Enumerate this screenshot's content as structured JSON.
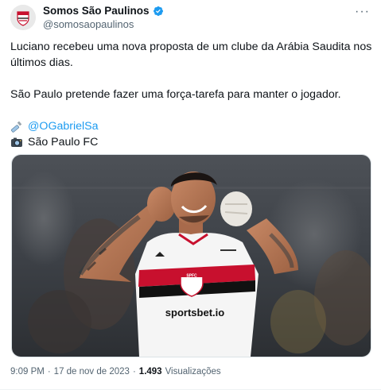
{
  "account": {
    "name": "Somos São Paulinos",
    "handle": "@somosaopaulinos",
    "badge": "verified-icon",
    "accent": "#1d9bf0"
  },
  "menu": {
    "more_label": "···"
  },
  "tweet": {
    "line1": "Luciano recebeu uma nova proposta de um clube da Arábia Saudita nos últimos dias.",
    "line2": "São Paulo pretende fazer uma força-tarefa para manter o jogador.",
    "credit_writer": "@OGabrielSa",
    "credit_photo": "São Paulo FC"
  },
  "media": {
    "shirt_sponsor": "sportsbet.io",
    "shirt_badge": "SPFC"
  },
  "meta": {
    "time": "9:09 PM",
    "date": "17 de nov de 2023",
    "views_count": "1.493",
    "views_label": "Visualizações"
  }
}
